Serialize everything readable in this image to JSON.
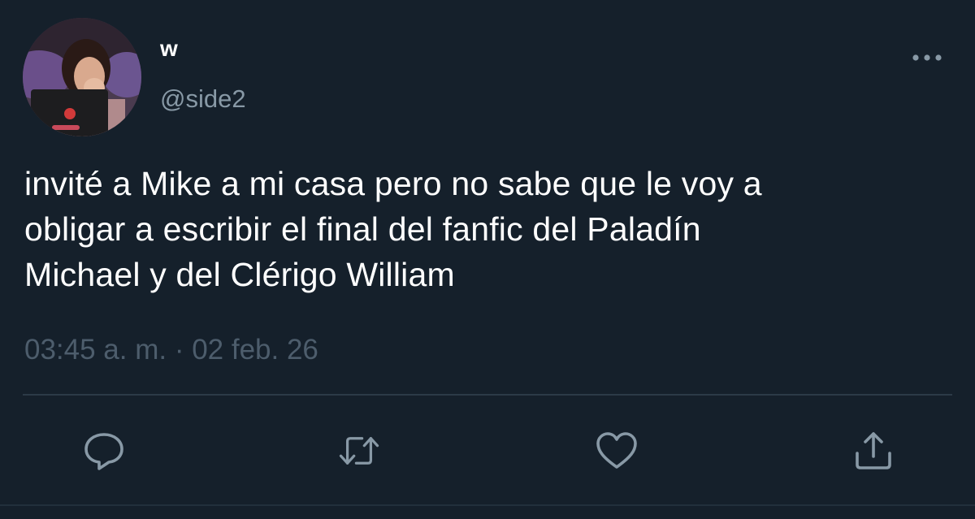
{
  "user": {
    "display_name": "w",
    "handle": "@side2"
  },
  "tweet": {
    "text_lines": [
      "invité a Mike a mi casa pero no sabe que le voy a",
      "obligar a escribir el final del fanfic del Paladín",
      "Michael y del Clérigo William"
    ],
    "timestamp": "03:45 a. m. · 02 feb. 26"
  },
  "actions": {
    "reply_icon": "reply-icon",
    "retweet_icon": "retweet-icon",
    "like_icon": "heart-icon",
    "share_icon": "share-icon",
    "more_icon": "more-options-icon"
  },
  "colors": {
    "background": "#15202b",
    "text": "#ffffff",
    "secondary": "#8899a6",
    "icon": "#8899a6",
    "divider": "#2c3a47"
  }
}
